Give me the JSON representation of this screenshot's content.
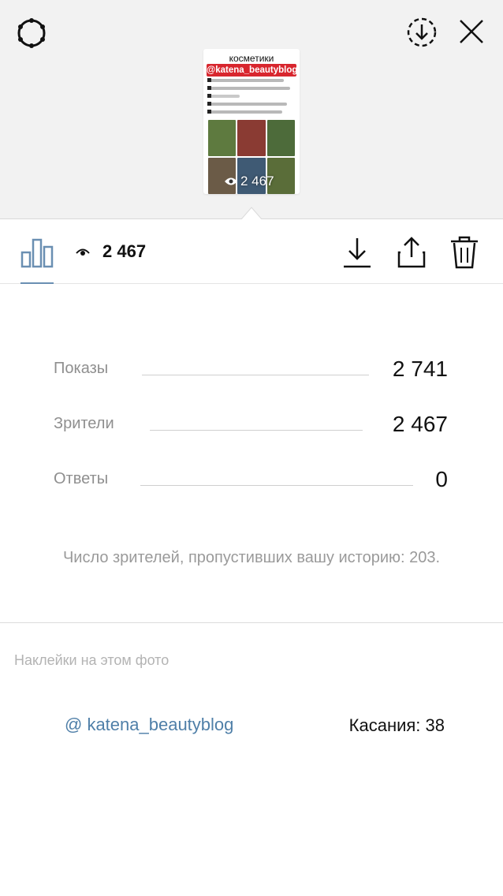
{
  "header": {
    "settings_icon": "settings-gear-icon",
    "save_icon": "save-download-ring-icon",
    "close_icon": "close-icon"
  },
  "story_preview": {
    "title": "косметики",
    "handle": "@katena_beautyblog",
    "views": "2 467",
    "accent_color": "#d8262e"
  },
  "toolbar": {
    "insights_icon": "bar-chart-icon",
    "viewers_icon": "eye-icon",
    "views_count": "2 467",
    "download_icon": "download-icon",
    "share_icon": "share-icon",
    "delete_icon": "trash-icon",
    "active_color": "#6a8fb2"
  },
  "stats": [
    {
      "label": "Показы",
      "value": "2 741"
    },
    {
      "label": "Зрители",
      "value": "2 467"
    },
    {
      "label": "Ответы",
      "value": "0"
    }
  ],
  "skip_text": "Число зрителей, пропустивших вашу историю: 203.",
  "stickers": {
    "title": "Наклейки на этом фото",
    "handle": "@  katena_beautyblog",
    "taps": "Касания: 38"
  }
}
